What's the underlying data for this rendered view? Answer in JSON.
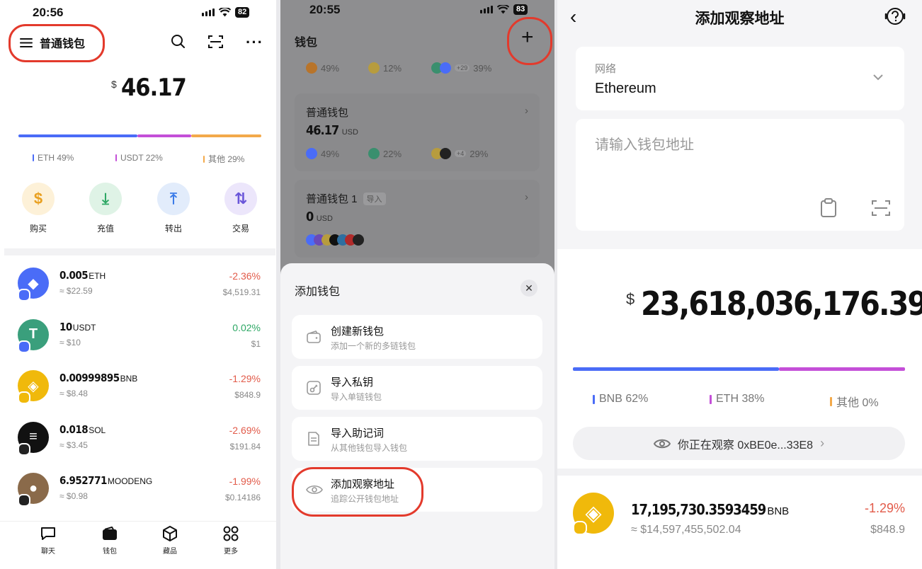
{
  "panel1": {
    "status": {
      "time": "20:56",
      "battery": "82"
    },
    "header": {
      "wallet_name": "普通钱包"
    },
    "balance": {
      "currency": "$",
      "value": "46.17"
    },
    "allocation": [
      {
        "label": "ETH 49%",
        "percent": 49,
        "color": "#4a6cf7"
      },
      {
        "label": "USDT 22%",
        "percent": 22,
        "color": "#c44fd8"
      },
      {
        "label": "其他 29%",
        "percent": 29,
        "color": "#f3a94a"
      }
    ],
    "actions": [
      {
        "label": "购买",
        "icon": "dollar-icon",
        "bg": "#fdf1d8",
        "fg": "#e9a020"
      },
      {
        "label": "充值",
        "icon": "download-icon",
        "bg": "#dff3e6",
        "fg": "#2ea865"
      },
      {
        "label": "转出",
        "icon": "upload-icon",
        "bg": "#e2ecfb",
        "fg": "#3b7be8"
      },
      {
        "label": "交易",
        "icon": "swap-icon",
        "bg": "#ece6fb",
        "fg": "#6a56d9"
      }
    ],
    "tokens": [
      {
        "amount": "0.005",
        "symbol": "ETH",
        "usd": "≈ $22.59",
        "change": "-2.36%",
        "price": "$4,519.31",
        "trend": "neg",
        "color": "#4a6cf7",
        "glyph": "◆"
      },
      {
        "amount": "10",
        "symbol": "USDT",
        "usd": "≈ $10",
        "change": "0.02%",
        "price": "$1",
        "trend": "pos",
        "color": "#3a9f7c",
        "glyph": "T"
      },
      {
        "amount": "0.00999895",
        "symbol": "BNB",
        "usd": "≈ $8.48",
        "change": "-1.29%",
        "price": "$848.9",
        "trend": "neg",
        "color": "#f0b90b",
        "glyph": "◈"
      },
      {
        "amount": "0.018",
        "symbol": "SOL",
        "usd": "≈ $3.45",
        "change": "-2.69%",
        "price": "$191.84",
        "trend": "neg",
        "color": "#111111",
        "glyph": "≡"
      },
      {
        "amount": "6.952771",
        "symbol": "MOODENG",
        "usd": "≈ $0.98",
        "change": "-1.99%",
        "price": "$0.14186",
        "trend": "neg",
        "color": "#8a6a4a",
        "glyph": "●"
      }
    ],
    "tabs": [
      {
        "label": "聊天",
        "icon": "chat-icon"
      },
      {
        "label": "钱包",
        "icon": "wallet-icon"
      },
      {
        "label": "藏品",
        "icon": "cube-icon"
      },
      {
        "label": "更多",
        "icon": "grid-icon"
      }
    ]
  },
  "panel2": {
    "status": {
      "time": "20:55",
      "battery": "83"
    },
    "title": "钱包",
    "top_row": [
      "49%",
      "12%",
      "39%"
    ],
    "top_row_badge": "+29",
    "wallets": [
      {
        "name": "普通钱包",
        "amount": "46.17",
        "unit": "USD",
        "stats": [
          "49%",
          "22%",
          "29%"
        ],
        "badge": "+4"
      },
      {
        "name": "普通钱包 1",
        "tag": "导入",
        "amount": "0",
        "unit": "USD"
      }
    ],
    "sheet": {
      "title": "添加钱包",
      "options": [
        {
          "title": "创建新钱包",
          "sub": "添加一个新的多链钱包",
          "icon": "wallet-add-icon"
        },
        {
          "title": "导入私钥",
          "sub": "导入单链钱包",
          "icon": "key-icon"
        },
        {
          "title": "导入助记词",
          "sub": "从其他钱包导入钱包",
          "icon": "document-icon"
        },
        {
          "title": "添加观察地址",
          "sub": "追踪公开钱包地址",
          "icon": "eye-icon"
        }
      ]
    }
  },
  "panel3": {
    "title": "添加观察地址",
    "network": {
      "label": "网络",
      "value": "Ethereum"
    },
    "address": {
      "placeholder": "请输入钱包地址"
    },
    "balance": {
      "currency": "$",
      "value": "23,618,036,176.39"
    },
    "allocation": [
      {
        "label": "BNB 62%",
        "percent": 62,
        "color": "#4a6cf7"
      },
      {
        "label": "ETH 38%",
        "percent": 38,
        "color": "#c44fd8"
      },
      {
        "label": "其他 0%",
        "percent": 0,
        "color": "#f3a94a"
      }
    ],
    "watching": "你正在观察 0xBE0e...33E8",
    "token": {
      "amount": "17,195,730.3593459",
      "symbol": "BNB",
      "usd": "≈ $14,597,455,502.04",
      "change": "-1.29%",
      "price": "$848.9"
    }
  }
}
